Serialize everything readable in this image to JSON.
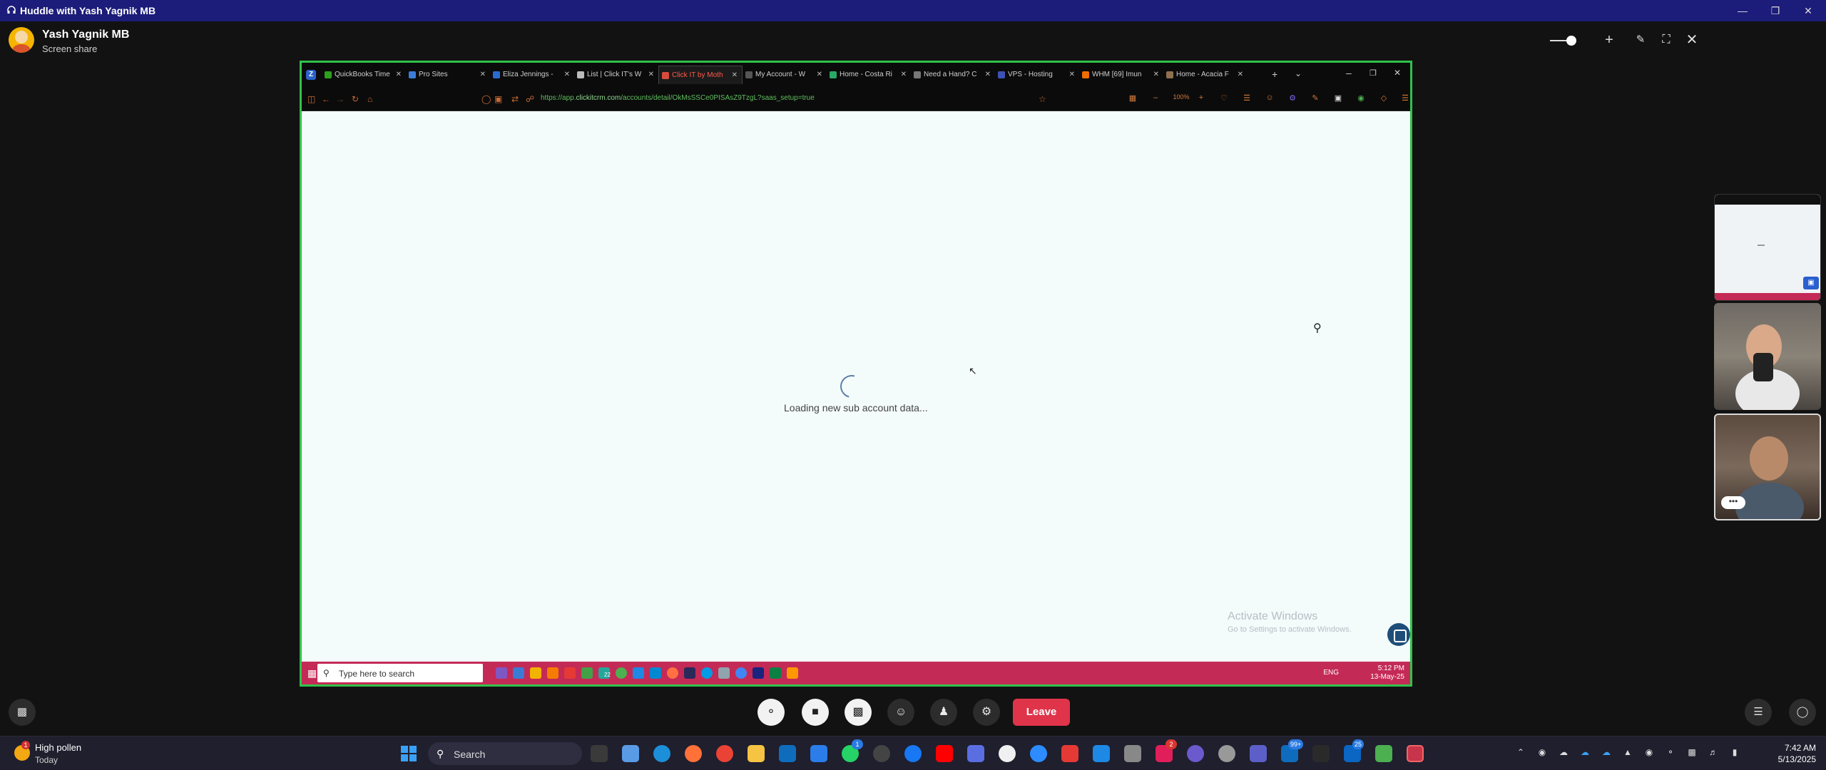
{
  "titlebar": {
    "title": "Huddle with Yash Yagnik MB"
  },
  "presenter": {
    "name": "Yash Yagnik MB",
    "subtitle": "Screen share"
  },
  "browser": {
    "tabs": [
      {
        "label": "QuickBooks Time",
        "color": "#2ca01c"
      },
      {
        "label": "Pro Sites",
        "color": "#3b7dd8"
      },
      {
        "label": "Eliza Jennings -",
        "color": "#2a6bd1"
      },
      {
        "label": "List | Click IT's W",
        "color": "#bbbbbb"
      },
      {
        "label": "Click IT by Moth",
        "color": "#d84b3c",
        "active": true
      },
      {
        "label": "My Account - W",
        "color": "#555555"
      },
      {
        "label": "Home - Costa Ri",
        "color": "#2aa865"
      },
      {
        "label": "Need a Hand? C",
        "color": "#777777"
      },
      {
        "label": "VPS - Hosting",
        "color": "#3f51b5"
      },
      {
        "label": "WHM [69] Imun",
        "color": "#ef6c00"
      },
      {
        "label": "Home - Acacia F",
        "color": "#8e6f4e"
      }
    ],
    "url_prefix": "https://app.",
    "url_domain": "clickitcrm.com",
    "url_path": "/accounts/detail/OkMsSSCe0PISAsZ9TzgL?saas_setup=true",
    "zoom": "100%"
  },
  "page": {
    "loading_text": "Loading new sub account data...",
    "watermark_title": "Activate Windows",
    "watermark_sub": "Go to Settings to activate Windows."
  },
  "inner_taskbar": {
    "search_placeholder": "Type here to search",
    "lang": "ENG",
    "time": "5:12 PM",
    "date": "13-May-25",
    "badge": "22"
  },
  "thumbs": {
    "more_label": "•••"
  },
  "controls": {
    "leave_label": "Leave"
  },
  "taskbar": {
    "weather_title": "High pollen",
    "weather_sub": "Today",
    "weather_badge": "1",
    "search_placeholder": "Search",
    "time": "7:42 AM",
    "date": "5/13/2025",
    "badge_whatsapp": "1",
    "badge_teams": "99+",
    "badge_linkedin": "25",
    "badge_red": "2"
  }
}
